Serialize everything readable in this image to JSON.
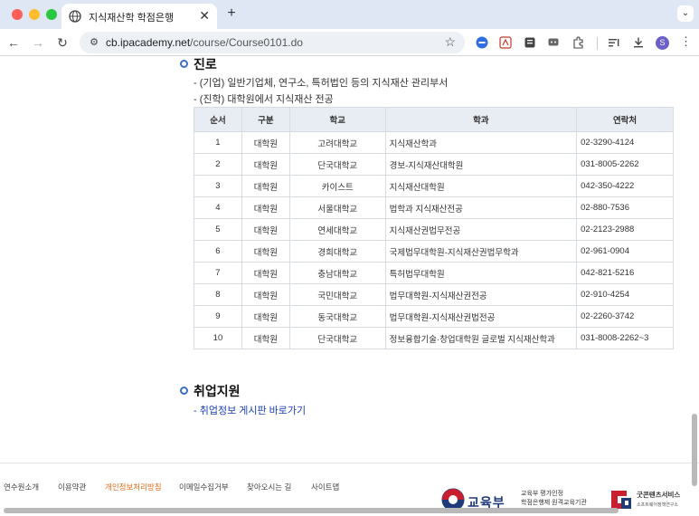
{
  "browser": {
    "tab_title": "지식재산학 학점은행",
    "tab_close": "✕",
    "new_tab": "+",
    "tab_menu": "⌄",
    "url_domain": "cb.ipacademy.net",
    "url_path": "/course/Course0101.do",
    "nav_back": "←",
    "nav_forward": "→",
    "nav_reload": "↻",
    "site_info_icon": "⚙",
    "bookmark_icon": "☆",
    "avatar_letter": "S",
    "more_icon": "⋮"
  },
  "career": {
    "heading": "진로",
    "lines": [
      "- (기업) 일반기업체, 연구소, 특허법인 등의 지식재산 관리부서",
      "- (진학) 대학원에서 지식재산 전공"
    ]
  },
  "table": {
    "headers": [
      "순서",
      "구분",
      "학교",
      "학과",
      "연락처"
    ],
    "rows": [
      [
        "1",
        "대학원",
        "고려대학교",
        "지식재산학과",
        "02-3290-4124"
      ],
      [
        "2",
        "대학원",
        "단국대학교",
        "경보-지식재산대학원",
        "031-8005-2262"
      ],
      [
        "3",
        "대학원",
        "카이스트",
        "지식재산대학원",
        "042-350-4222"
      ],
      [
        "4",
        "대학원",
        "서울대학교",
        "법학과 지식재산전공",
        "02-880-7536"
      ],
      [
        "5",
        "대학원",
        "연세대학교",
        "지식재산권법무전공",
        "02-2123-2988"
      ],
      [
        "6",
        "대학원",
        "경희대학교",
        "국제법무대학원-지식재산권법무학과",
        "02-961-0904"
      ],
      [
        "7",
        "대학원",
        "충남대학교",
        "특허법무대학원",
        "042-821-5216"
      ],
      [
        "8",
        "대학원",
        "국민대학교",
        "법무대학원-지식재산권전공",
        "02-910-4254"
      ],
      [
        "9",
        "대학원",
        "동국대학교",
        "법무대학원-지식재산권법전공",
        "02-2260-3742"
      ],
      [
        "10",
        "대학원",
        "단국대학교",
        "정보융합기술·창업대학원 글로벌 지식재산학과",
        "031-8008-2262~3"
      ]
    ]
  },
  "employment": {
    "heading": "취업지원",
    "link": "- 취업정보 게시판 바로가기"
  },
  "footer": {
    "links": [
      "연수원소개",
      "이용약관",
      "개인정보처리방침",
      "이메일수집거부",
      "찾아오시는 길",
      "사이트맵"
    ],
    "moe_name": "교육부",
    "moe_sub_1": "교육부 평가인정",
    "moe_sub_2": "학점은행제 원격교육기관",
    "gc_title": "굿콘텐츠서비스",
    "gc_sub": "소프트웨어정책연구소"
  },
  "colors": {
    "accent_blue": "#3a6ec8",
    "link_blue": "#1a3fb5",
    "footer_active": "#e06c1b"
  }
}
